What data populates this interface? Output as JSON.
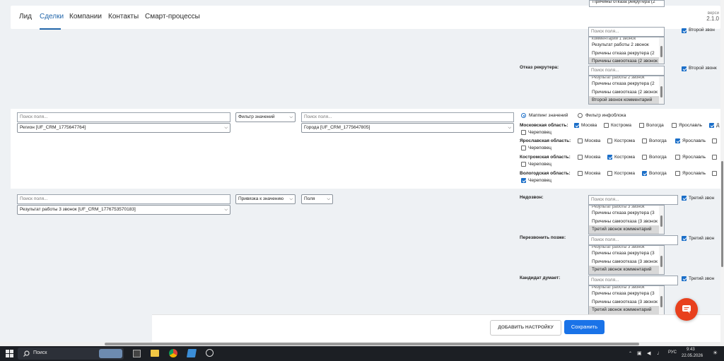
{
  "nav": {
    "items": [
      "Лид",
      "Сделки",
      "Компании",
      "Контакты",
      "Смарт-процессы"
    ],
    "version_label": "верси",
    "version_value": "2.1.0"
  },
  "top_section": {
    "row0_option": "Причины отказа рекрутера (2",
    "row0_search": "Поиск поля...",
    "row0_check_label": "Второй звон",
    "row0_list": [
      "комментарий 1 звонок",
      "Результат работы 2 звонок",
      "Причины отказа рекрутера (2",
      "Причины самоотказа (2 звонок"
    ],
    "recruiter_label": "Отказ рекрутера:",
    "recruiter_search": "Поиск поля...",
    "recruiter_check_label": "Второй звонк",
    "recruiter_list": [
      "Результат работы 2 звонок",
      "Причины отказа рекрутера (2",
      "Причины самоотказа (2 звонок",
      "Второй звонок комментарий"
    ]
  },
  "region_row": {
    "search1": "Поиск поля...",
    "select1": "Регион [UF_CRM_1775647764]",
    "filter_select": "Фильтр значений",
    "search2": "Поиск поля...",
    "select2": "Города [UF_CRM_1775647805]",
    "radio_mapping": "Маппинг значений",
    "radio_filter": "Фильтр инфоблока",
    "groups": [
      {
        "label": "Московская область:",
        "options": [
          {
            "name": "Москва",
            "checked": true
          },
          {
            "name": "Кострома",
            "checked": false
          },
          {
            "name": "Вологда",
            "checked": false
          },
          {
            "name": "Ярославль",
            "checked": false
          },
          {
            "name": "Д",
            "checked": true
          },
          {
            "name": "Череповец",
            "checked": false
          }
        ]
      },
      {
        "label": "Ярославская область:",
        "options": [
          {
            "name": "Москва",
            "checked": false
          },
          {
            "name": "Кострома",
            "checked": false
          },
          {
            "name": "Вологда",
            "checked": false
          },
          {
            "name": "Ярославль",
            "checked": true
          },
          {
            "name": "",
            "checked": false
          },
          {
            "name": "Череповец",
            "checked": false
          }
        ]
      },
      {
        "label": "Костромская область:",
        "options": [
          {
            "name": "Москва",
            "checked": false
          },
          {
            "name": "Кострома",
            "checked": true
          },
          {
            "name": "Вологда",
            "checked": false
          },
          {
            "name": "Ярославль",
            "checked": false
          },
          {
            "name": "",
            "checked": false
          },
          {
            "name": "Череповец",
            "checked": false
          }
        ]
      },
      {
        "label": "Вологодская область:",
        "options": [
          {
            "name": "Москва",
            "checked": false
          },
          {
            "name": "Кострома",
            "checked": false
          },
          {
            "name": "Вологда",
            "checked": true
          },
          {
            "name": "Ярославль",
            "checked": false
          },
          {
            "name": "",
            "checked": false
          },
          {
            "name": "Череповец",
            "checked": true
          }
        ]
      }
    ]
  },
  "result_row": {
    "search1": "Поиск поля...",
    "select1": "Результат работы 3 звонок [UF_CRM_1776753570183]",
    "bind_select": "Привязка к значению",
    "fields_select": "Поля",
    "mappings": [
      {
        "label": "Недозвон:",
        "search": "Поиск поля...",
        "check_label": "Третий звон",
        "list": [
          "Результат работы 3 звонок",
          "Причины отказа рекрутера (3",
          "Причины самоотказа (3 звонок",
          "Третий звонок комментарий"
        ]
      },
      {
        "label": "Перезвонить позже:",
        "search": "Поиск поля...",
        "check_label": "Третий звон",
        "list": [
          "Результат работы 3 звонок",
          "Причины отказа рекрутера (3",
          "Причины самоотказа (3 звонок",
          "Третий звонок комментарий"
        ]
      },
      {
        "label": "Кандидат думает:",
        "search": "Поиск поля...",
        "check_label": "Третий звон",
        "list": [
          "Результат работы 3 звонок",
          "Причины отказа рекрутера (3",
          "Причины самоотказа (3 звонок",
          "Третий звонок комментарий"
        ]
      }
    ]
  },
  "footer": {
    "add_label": "ДОБАВИТЬ НАСТРОЙКУ",
    "save_label": "Сохранить"
  },
  "taskbar": {
    "search_label": "Поиск",
    "lang": "РУС",
    "time": "9:43",
    "date": "22.05.2026"
  }
}
